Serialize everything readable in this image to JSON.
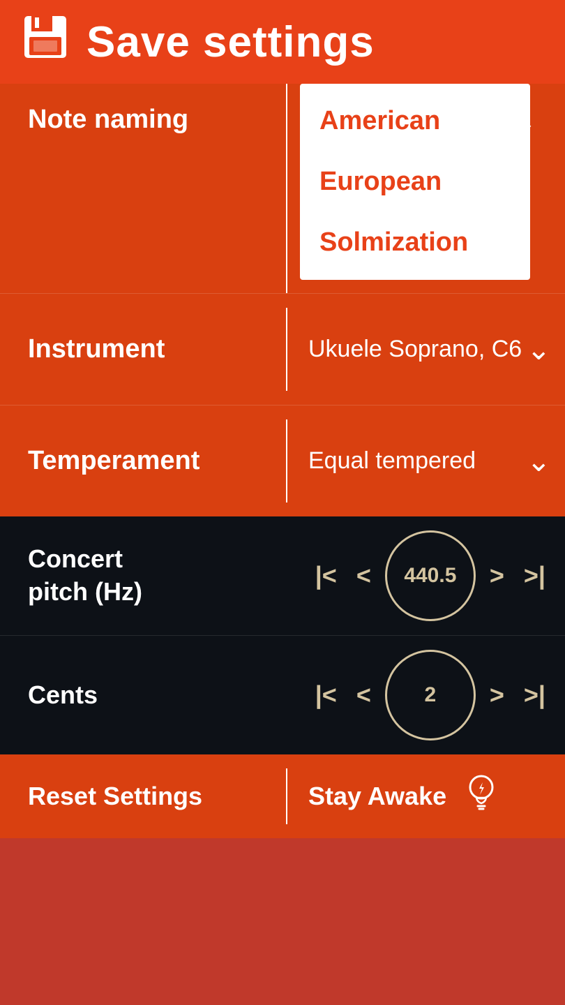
{
  "header": {
    "title": "Save settings",
    "icon_name": "floppy-disk-icon"
  },
  "settings": {
    "note_naming": {
      "label": "Note naming",
      "dropdown_open": true,
      "options": [
        "American",
        "European",
        "Solmization"
      ],
      "selected": "American"
    },
    "instrument": {
      "label": "Instrument",
      "value": "Ukuele Soprano, C6"
    },
    "temperament": {
      "label": "Temperament",
      "value": "Equal tempered"
    }
  },
  "pitch": {
    "concert_pitch": {
      "label": "Concert pitch (Hz)",
      "value": "440.5"
    },
    "cents": {
      "label": "Cents",
      "value": "2"
    }
  },
  "bottom": {
    "reset_label": "Reset Settings",
    "stay_awake_label": "Stay Awake"
  },
  "controls": {
    "skip_back": "|<",
    "prev": "<",
    "next": ">",
    "skip_forward": ">|"
  },
  "colors": {
    "header_bg": "#e84118",
    "settings_bg": "#d94010",
    "dark_bg": "#0d1117",
    "accent": "#d4c4a0",
    "dropdown_text": "#e84118",
    "white": "#ffffff"
  }
}
